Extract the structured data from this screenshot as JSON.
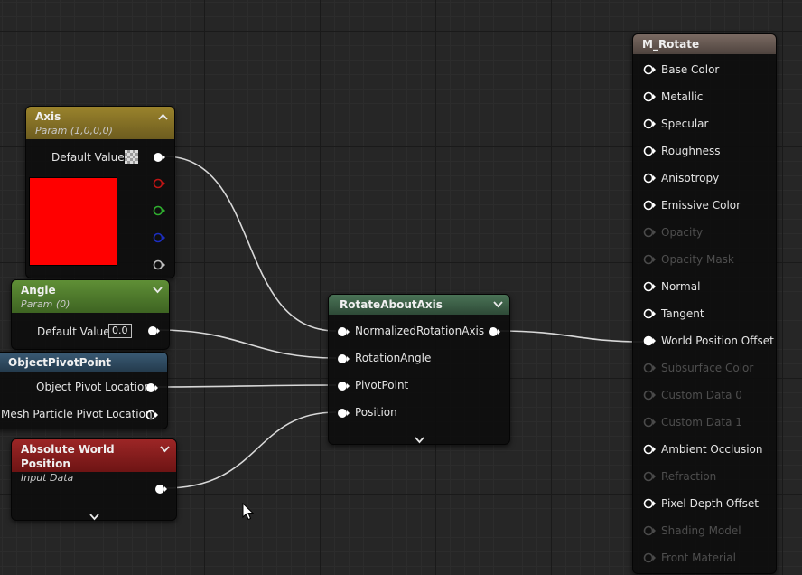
{
  "nodes": {
    "axis": {
      "title": "Axis",
      "subtitle": "Param (1,0,0,0)",
      "default_label": "Default Value",
      "header_color": "#8a7526",
      "swatch_color": "#ff0000"
    },
    "angle": {
      "title": "Angle",
      "subtitle": "Param (0)",
      "default_label": "Default Value",
      "default_value": "0.0",
      "header_color": "#4f7a2c"
    },
    "pivot": {
      "title": "ObjectPivotPoint",
      "outputs": [
        "Object Pivot Location",
        "Mesh Particle Pivot Location"
      ],
      "header_color": "#2f4a60"
    },
    "abswp": {
      "title": "Absolute World Position",
      "subtitle": "Input Data",
      "header_color": "#8c1f1f"
    },
    "rotate": {
      "title": "RotateAboutAxis",
      "inputs": [
        "NormalizedRotationAxis",
        "RotationAngle",
        "PivotPoint",
        "Position"
      ],
      "header_color": "#3d6048"
    },
    "material": {
      "title": "M_Rotate",
      "header_color": "#6a5a52",
      "pins": [
        {
          "label": "Base Color",
          "active": true
        },
        {
          "label": "Metallic",
          "active": true
        },
        {
          "label": "Specular",
          "active": true
        },
        {
          "label": "Roughness",
          "active": true
        },
        {
          "label": "Anisotropy",
          "active": true
        },
        {
          "label": "Emissive Color",
          "active": true
        },
        {
          "label": "Opacity",
          "active": false
        },
        {
          "label": "Opacity Mask",
          "active": false
        },
        {
          "label": "Normal",
          "active": true
        },
        {
          "label": "Tangent",
          "active": true
        },
        {
          "label": "World Position Offset",
          "active": true,
          "connected": true
        },
        {
          "label": "Subsurface Color",
          "active": false
        },
        {
          "label": "Custom Data 0",
          "active": false
        },
        {
          "label": "Custom Data 1",
          "active": false
        },
        {
          "label": "Ambient Occlusion",
          "active": true
        },
        {
          "label": "Refraction",
          "active": false
        },
        {
          "label": "Pixel Depth Offset",
          "active": true
        },
        {
          "label": "Shading Model",
          "active": false
        },
        {
          "label": "Front Material",
          "active": false
        }
      ]
    }
  },
  "icons": {
    "collapse": "chevron-up-icon",
    "expand": "chevron-down-icon",
    "cursor": "mouse-cursor-icon"
  }
}
